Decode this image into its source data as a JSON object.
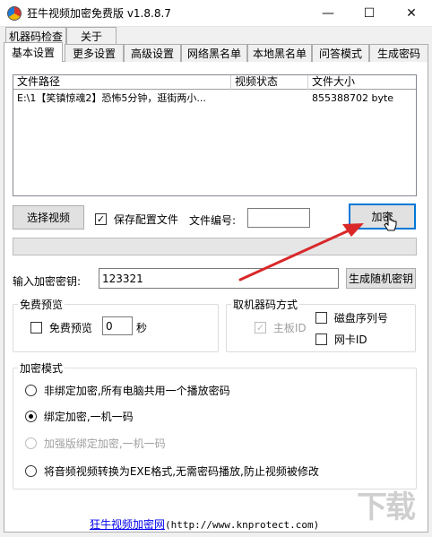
{
  "window": {
    "title": "狂牛视频加密免费版 v1.8.8.7",
    "minimize": "—",
    "maximize": "☐",
    "close": "✕"
  },
  "tabs": {
    "row1": [
      "机器码检查",
      "关于"
    ],
    "row2": [
      "基本设置",
      "更多设置",
      "高级设置",
      "网络黑名单",
      "本地黑名单",
      "问答模式",
      "生成密码"
    ],
    "active": "基本设置"
  },
  "file_list": {
    "columns": [
      "文件路径",
      "视频状态",
      "文件大小"
    ],
    "rows": [
      {
        "path": "E:\\1【笑镇惊魂2】恐怖5分钟，逛街两小...",
        "status": "",
        "size": "855388702 byte"
      }
    ]
  },
  "controls": {
    "select_video": "选择视频",
    "save_config_label": "保存配置文件",
    "save_config_checked": true,
    "file_number_label": "文件编号:",
    "file_number_value": "",
    "encrypt_button": "加密"
  },
  "progress": {
    "value": 0
  },
  "key": {
    "label": "输入加密密钥:",
    "value": "123321",
    "generate_button": "生成随机密钥"
  },
  "free_preview": {
    "legend": "免费预览",
    "checkbox_label": "免费预览",
    "checked": false,
    "seconds_value": "0",
    "seconds_unit": "秒"
  },
  "machine_code": {
    "legend": "取机器码方式",
    "options": [
      {
        "label": "主板ID",
        "checked": true,
        "disabled": true
      },
      {
        "label": "磁盘序列号",
        "checked": false,
        "disabled": false
      },
      {
        "label": "网卡ID",
        "checked": false,
        "disabled": false
      }
    ]
  },
  "encrypt_mode": {
    "legend": "加密模式",
    "options": [
      {
        "label": "非绑定加密,所有电脑共用一个播放密码",
        "selected": false,
        "disabled": false
      },
      {
        "label": "绑定加密,一机一码",
        "selected": true,
        "disabled": false
      },
      {
        "label": "加强版绑定加密,一机一码",
        "selected": false,
        "disabled": true
      },
      {
        "label": "将音频视频转换为EXE格式,无需密码播放,防止视频被修改",
        "selected": false,
        "disabled": false
      }
    ]
  },
  "footer": {
    "link_name": "狂牛视频加密网",
    "link_url": "(http://www.knprotect.com)"
  },
  "colors": {
    "accent": "#0078d7",
    "annotation_arrow": "#d9282a",
    "link": "#0000ee"
  }
}
